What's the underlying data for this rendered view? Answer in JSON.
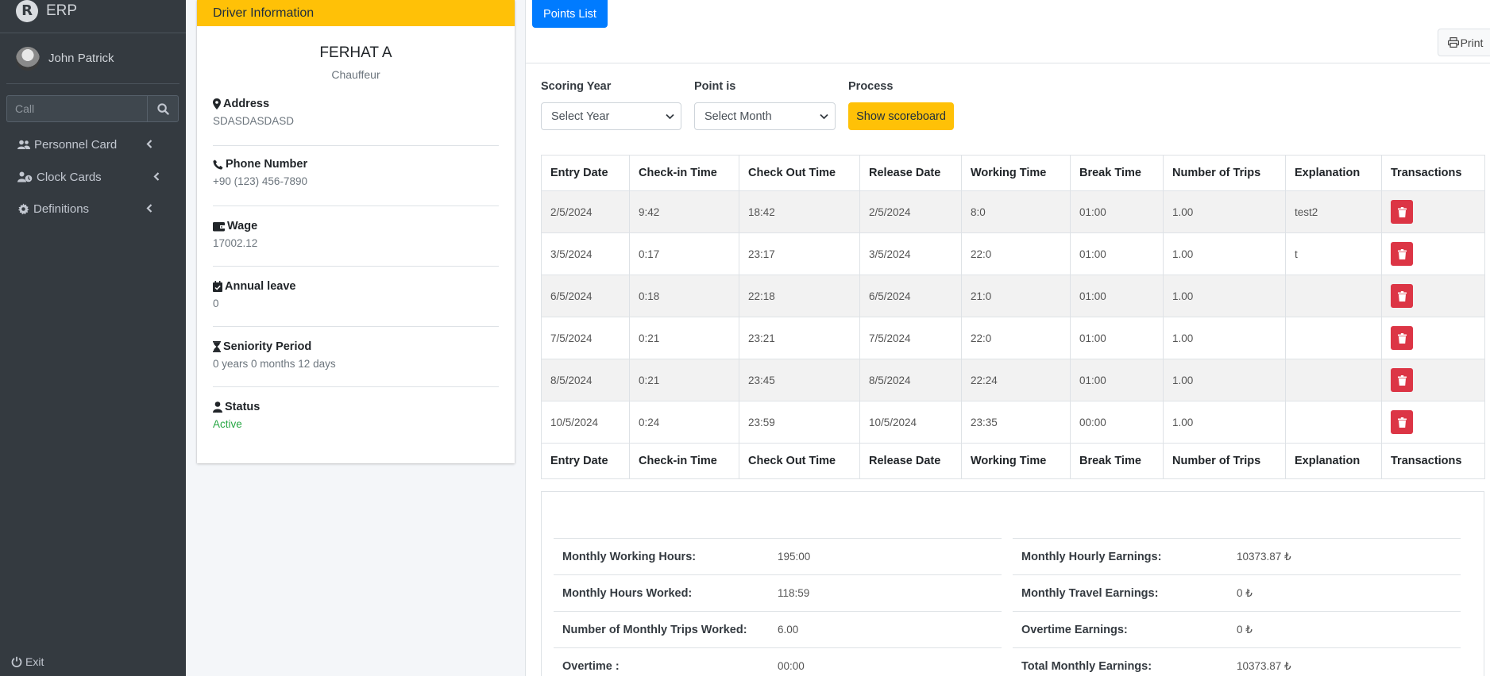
{
  "sidebar": {
    "brand_logo": "R",
    "brand": "ERP",
    "user_name": "John Patrick",
    "search_placeholder": "Call",
    "nav": [
      {
        "label": "Personnel Card",
        "icon": "users-icon"
      },
      {
        "label": "Clock Cards",
        "icon": "user-clock-icon"
      },
      {
        "label": "Definitions",
        "icon": "gear-icon"
      }
    ],
    "exit_label": "Exit"
  },
  "driver": {
    "header": "Driver Information",
    "name": "FERHAT A",
    "role": "Chauffeur",
    "fields": [
      {
        "label": "Address",
        "value": "SDASDASDASD",
        "icon": "map-marker-icon"
      },
      {
        "label": "Phone Number",
        "value": "+90 (123) 456-7890",
        "icon": "phone-icon"
      },
      {
        "label": "Wage",
        "value": "17002.12",
        "icon": "wallet-icon"
      },
      {
        "label": "Annual leave",
        "value": "0",
        "icon": "calendar-check-icon"
      },
      {
        "label": "Seniority Period",
        "value": "0 years 0 months 12 days",
        "icon": "hourglass-icon"
      },
      {
        "label": "Status",
        "value": "Active",
        "icon": "user-icon"
      }
    ]
  },
  "toolbar": {
    "points_list": "Points List",
    "print": "Print"
  },
  "filters": {
    "year_label": "Scoring Year",
    "year_value": "Select Year",
    "month_label": "Point is",
    "month_value": "Select Month",
    "process_label": "Process",
    "show_button": "Show scoreboard"
  },
  "table": {
    "headers": [
      "Entry Date",
      "Check-in Time",
      "Check Out Time",
      "Release Date",
      "Working Time",
      "Break Time",
      "Number of Trips",
      "Explanation",
      "Transactions"
    ],
    "rows": [
      [
        "2/5/2024",
        "9:42",
        "18:42",
        "2/5/2024",
        "8:0",
        "01:00",
        "1.00",
        "test2"
      ],
      [
        "3/5/2024",
        "0:17",
        "23:17",
        "3/5/2024",
        "22:0",
        "01:00",
        "1.00",
        "t"
      ],
      [
        "6/5/2024",
        "0:18",
        "22:18",
        "6/5/2024",
        "21:0",
        "01:00",
        "1.00",
        ""
      ],
      [
        "7/5/2024",
        "0:21",
        "23:21",
        "7/5/2024",
        "22:0",
        "01:00",
        "1.00",
        ""
      ],
      [
        "8/5/2024",
        "0:21",
        "23:45",
        "8/5/2024",
        "22:24",
        "01:00",
        "1.00",
        ""
      ],
      [
        "10/5/2024",
        "0:24",
        "23:59",
        "10/5/2024",
        "23:35",
        "00:00",
        "1.00",
        ""
      ]
    ]
  },
  "summary": {
    "left": [
      {
        "label": "Monthly Working Hours:",
        "value": "195:00"
      },
      {
        "label": "Monthly Hours Worked:",
        "value": "118:59"
      },
      {
        "label": "Number of Monthly Trips Worked:",
        "value": "6.00"
      },
      {
        "label": "Overtime :",
        "value": "00:00"
      }
    ],
    "right": [
      {
        "label": "Monthly Hourly Earnings:",
        "value": "10373.87 ₺"
      },
      {
        "label": "Monthly Travel Earnings:",
        "value": "0 ₺"
      },
      {
        "label": "Overtime Earnings:",
        "value": "0 ₺"
      },
      {
        "label": "Total Monthly Earnings:",
        "value": "10373.87 ₺"
      }
    ]
  },
  "colors": {
    "sidebar_bg": "#343a40",
    "warning": "#ffc107",
    "primary": "#007bff",
    "danger": "#dc3545",
    "success": "#28a745"
  }
}
